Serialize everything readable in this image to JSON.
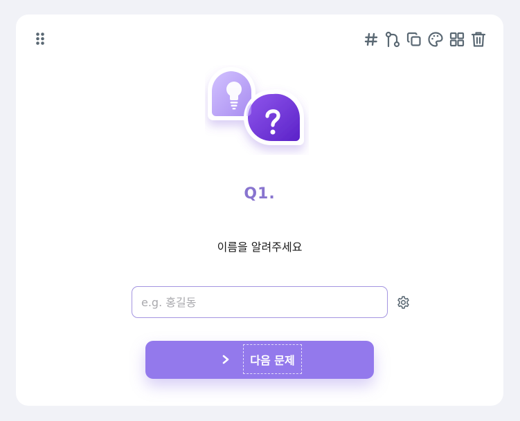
{
  "toolbar": {
    "icons": [
      "hash-icon",
      "branch-icon",
      "copy-icon",
      "palette-icon",
      "grid-icon",
      "trash-icon"
    ]
  },
  "question": {
    "number": "Q1.",
    "text": "이름을 알려주세요"
  },
  "answer": {
    "value": "",
    "placeholder": "e.g. 홍길동"
  },
  "next_button": {
    "label": "다음 문제"
  },
  "colors": {
    "accent": "#9379ec",
    "accent_text": "#8874cf",
    "icon": "#5a6873",
    "background": "#f1f2f7"
  }
}
